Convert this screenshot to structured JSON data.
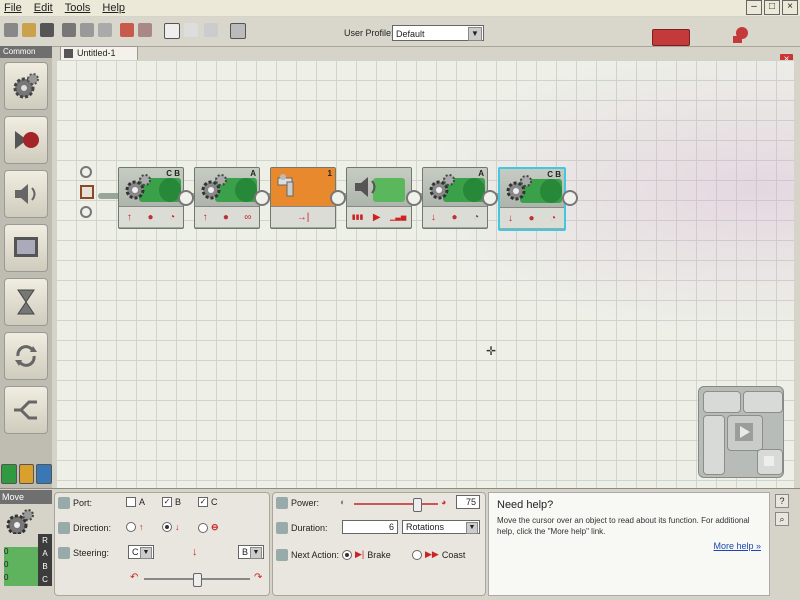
{
  "menu": {
    "items": [
      "File",
      "Edit",
      "Tools",
      "Help"
    ]
  },
  "window": {
    "min": "–",
    "max": "□",
    "close": "×"
  },
  "toolbar": {
    "profile_label": "User Profile:",
    "profile_value": "Default"
  },
  "palette": {
    "title": "Common"
  },
  "document": {
    "tab": "Untitled-1",
    "close": "×"
  },
  "program": {
    "blocks": [
      {
        "type": "move",
        "port": "C B",
        "bottom": [
          "↑",
          "●",
          "◔"
        ]
      },
      {
        "type": "motor",
        "port": "A",
        "bottom": [
          "↑",
          "●",
          "∞"
        ]
      },
      {
        "type": "wait",
        "port": "1",
        "bottom": [
          "→|"
        ]
      },
      {
        "type": "sound",
        "port": "",
        "bottom": [
          "▮▮▮",
          "▶",
          "▁▃▅"
        ]
      },
      {
        "type": "motor",
        "port": "A",
        "bottom": [
          "↓",
          "●",
          "◔"
        ]
      },
      {
        "type": "move",
        "port": "C B",
        "bottom": [
          "↓",
          "●",
          "◔"
        ]
      }
    ]
  },
  "config": {
    "title": "Move",
    "port_label": "Port:",
    "ports": [
      {
        "name": "A",
        "checked": false
      },
      {
        "name": "B",
        "checked": true
      },
      {
        "name": "C",
        "checked": true
      }
    ],
    "direction_label": "Direction:",
    "steering_label": "Steering:",
    "steering_left": "C",
    "steering_right": "B",
    "power_label": "Power:",
    "power_value": "75",
    "power_fraction": 0.75,
    "steering_fraction": 0.5,
    "duration_label": "Duration:",
    "duration_value": "6",
    "duration_unit": "Rotations",
    "next_action_label": "Next Action:",
    "brake_label": "Brake",
    "coast_label": "Coast",
    "port_rows": [
      "R",
      "A",
      "B",
      "C"
    ],
    "port_values": [
      "0",
      "0",
      "0"
    ]
  },
  "help": {
    "title": "Need help?",
    "body": "Move the cursor over an object to read about its function. For additional help, click the \"More help\" link.",
    "link": "More help »"
  },
  "colors": {
    "move_green": "#3aa14a",
    "wait_orange": "#e8892e",
    "selection_cyan": "#41c8e0",
    "record_red": "#c43a3a"
  }
}
